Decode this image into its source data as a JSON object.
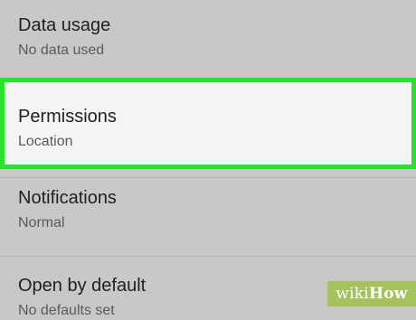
{
  "settings": {
    "items": [
      {
        "title": "Data usage",
        "subtitle": "No data used"
      },
      {
        "title": "Permissions",
        "subtitle": "Location"
      },
      {
        "title": "Notifications",
        "subtitle": "Normal"
      },
      {
        "title": "Open by default",
        "subtitle": "No defaults set"
      }
    ]
  },
  "highlight": {
    "item": "Permissions",
    "color": "#27e32a"
  },
  "colors": {
    "background": "#c8c8c8",
    "highlighted_background": "#f4f4f4",
    "title_text": "#1f1f1f",
    "subtitle_text": "#5b5b5b"
  },
  "watermark": {
    "prefix": "wiki",
    "suffix": "How"
  }
}
